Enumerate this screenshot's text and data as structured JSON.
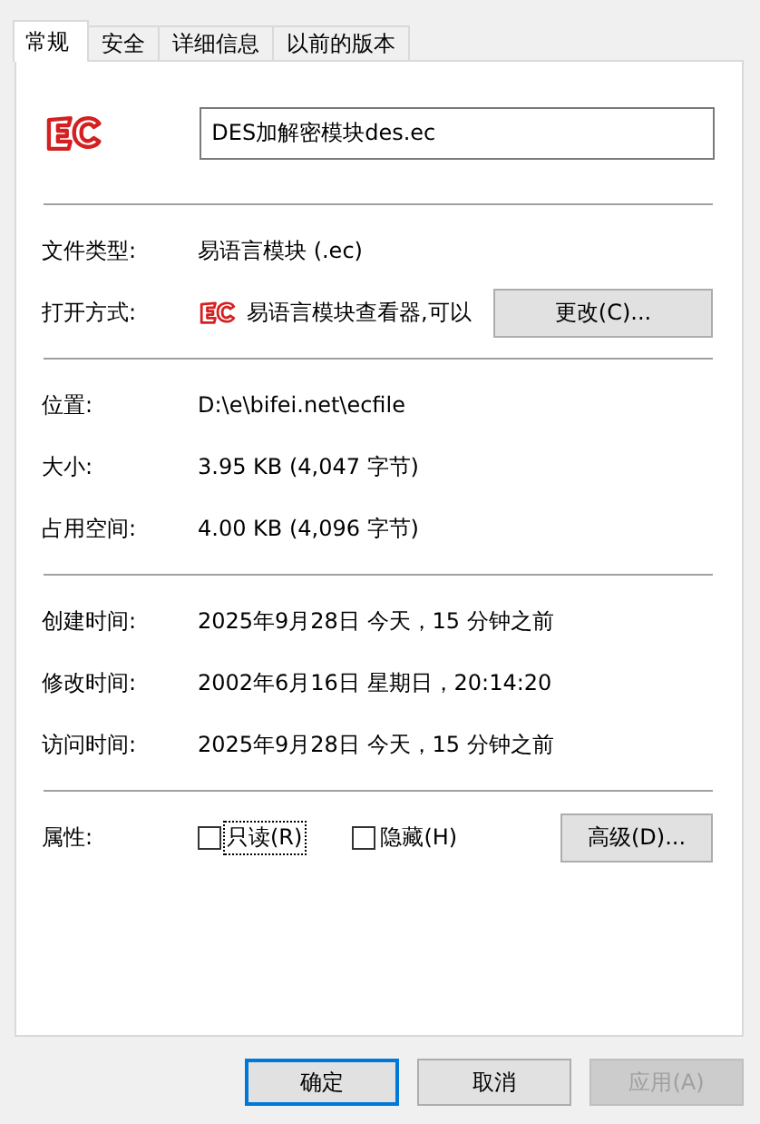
{
  "tabs": [
    {
      "label": "常规",
      "selected": true
    },
    {
      "label": "安全",
      "selected": false
    },
    {
      "label": "详细信息",
      "selected": false
    },
    {
      "label": "以前的版本",
      "selected": false
    }
  ],
  "file": {
    "name": "DES加解密模块des.ec"
  },
  "groups": [
    [
      {
        "kind": "text",
        "label": "文件类型:",
        "value": "易语言模块 (.ec)"
      },
      {
        "kind": "open_with",
        "label": "打开方式:",
        "value": "易语言模块查看器,可以",
        "button": "更改(C)..."
      }
    ],
    [
      {
        "kind": "text",
        "label": "位置:",
        "value": "D:\\e\\bifei.net\\ecfile"
      },
      {
        "kind": "text",
        "label": "大小:",
        "value": "3.95 KB (4,047 字节)"
      },
      {
        "kind": "text",
        "label": "占用空间:",
        "value": "4.00 KB (4,096 字节)"
      }
    ],
    [
      {
        "kind": "text",
        "label": "创建时间:",
        "value": "2025年9月28日 今天，15 分钟之前"
      },
      {
        "kind": "text",
        "label": "修改时间:",
        "value": "2002年6月16日 星期日，20:14:20"
      },
      {
        "kind": "text",
        "label": "访问时间:",
        "value": "2025年9月28日 今天，15 分钟之前"
      }
    ]
  ],
  "attributes": {
    "label": "属性:",
    "options": [
      {
        "label": "只读(R)",
        "checked": false,
        "focused": true
      },
      {
        "label": "隐藏(H)",
        "checked": false,
        "focused": false
      }
    ],
    "button": "高级(D)..."
  },
  "buttons": [
    {
      "label": "确定",
      "default": true,
      "disabled": false
    },
    {
      "label": "取消",
      "default": false,
      "disabled": false
    },
    {
      "label": "应用(A)",
      "default": false,
      "disabled": true
    }
  ]
}
